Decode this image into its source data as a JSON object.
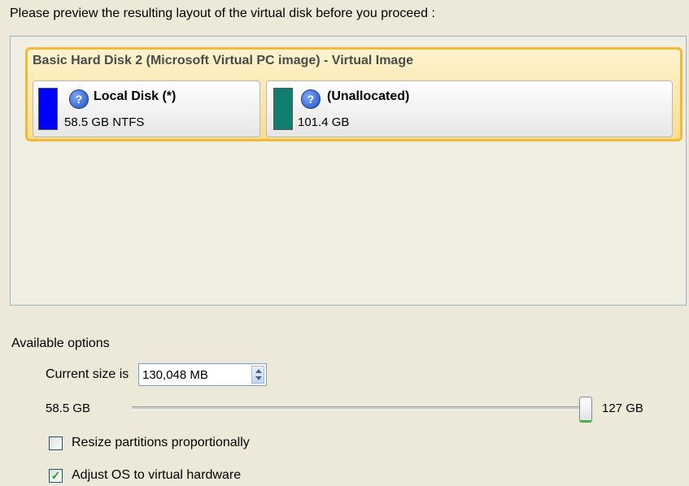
{
  "intro_text": "Please preview the resulting layout of the virtual disk before you proceed :",
  "disk": {
    "title": "Basic Hard Disk 2 (Microsoft Virtual PC image) - Virtual Image",
    "partitions": [
      {
        "name": "Local Disk (*)",
        "size": "58.5 GB NTFS",
        "color": "#0000FF",
        "icon": "help-icon"
      },
      {
        "name": "(Unallocated)",
        "size": "101.4 GB",
        "color": "#0E7E6E",
        "icon": "help-icon"
      }
    ]
  },
  "options": {
    "title": "Available options",
    "current_size_label": "Current size is",
    "current_size_value": "130,048 MB",
    "slider": {
      "min_label": "58.5 GB",
      "max_label": "127 GB",
      "value_fraction": 0.98
    },
    "checkboxes": [
      {
        "label": "Resize partitions proportionally",
        "checked": false
      },
      {
        "label": "Adjust OS to virtual hardware",
        "checked": true
      }
    ]
  },
  "colors": {
    "accent": "#F2B83A",
    "checkmark": "#21A121"
  }
}
